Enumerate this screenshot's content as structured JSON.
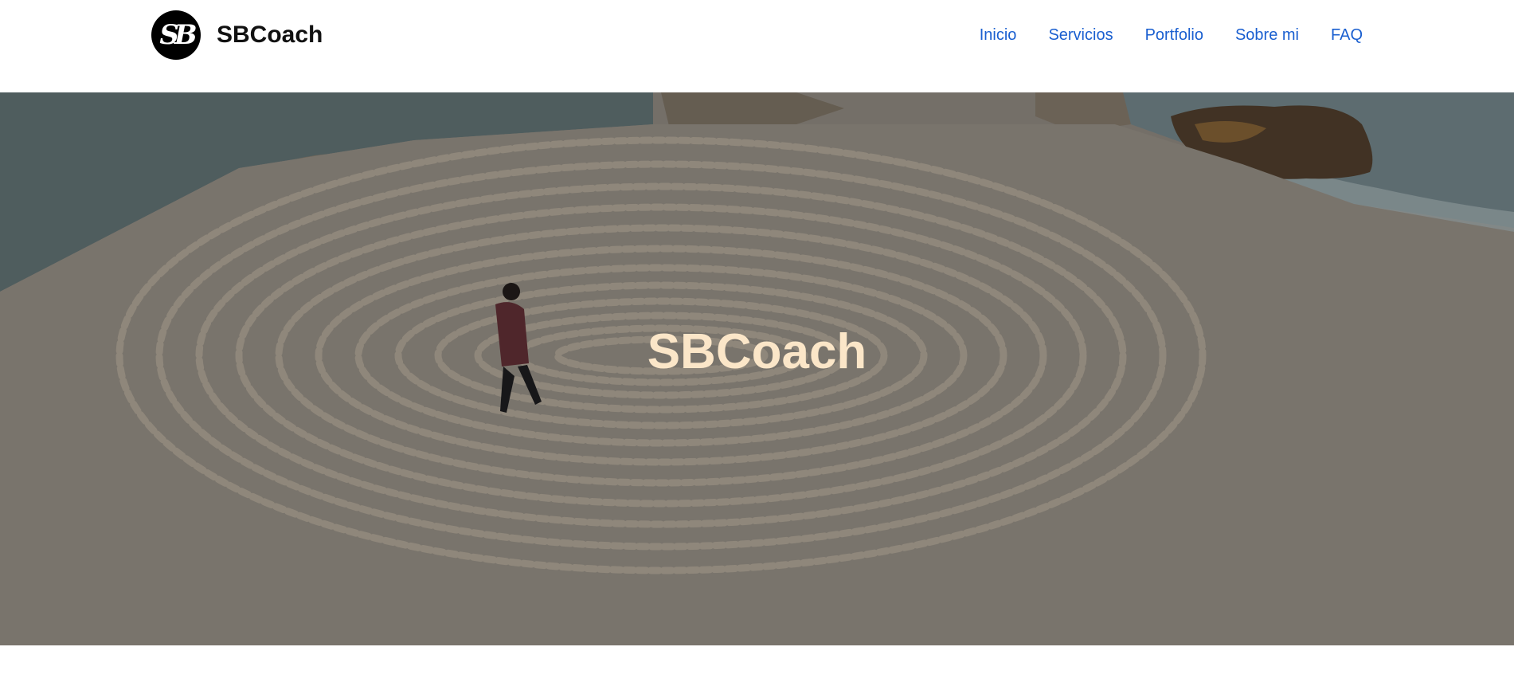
{
  "brand": {
    "logo_text": "SB",
    "name": "SBCoach"
  },
  "nav": {
    "items": [
      {
        "label": "Inicio"
      },
      {
        "label": "Servicios"
      },
      {
        "label": "Portfolio"
      },
      {
        "label": "Sobre mi"
      },
      {
        "label": "FAQ"
      }
    ]
  },
  "hero": {
    "title": "SBCoach"
  },
  "colors": {
    "nav_link": "#1a5fd0",
    "hero_title": "#fbe6c8",
    "sand": "#857f77",
    "sea": "#55666a"
  }
}
